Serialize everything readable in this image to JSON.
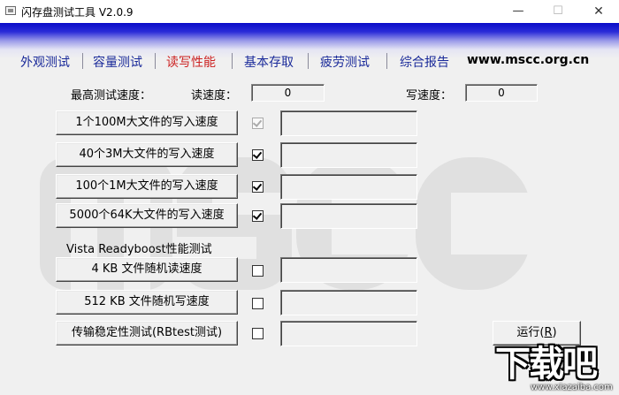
{
  "window": {
    "title": "闪存盘测试工具  V2.0.9",
    "minimize_symbol": "—",
    "maximize_symbol": "☐",
    "close_symbol": "✕"
  },
  "tabs": [
    {
      "label": "外观测试",
      "active": false
    },
    {
      "label": "容量测试",
      "active": false
    },
    {
      "label": "读写性能",
      "active": true
    },
    {
      "label": "基本存取",
      "active": false
    },
    {
      "label": "疲劳测试",
      "active": false
    },
    {
      "label": "综合报告",
      "active": false
    }
  ],
  "site_url": "www.mscc.org.cn",
  "speed": {
    "max_label": "最高测试速度：",
    "read_label": "读速度：",
    "read_value": "0",
    "write_label": "写速度：",
    "write_value": "0"
  },
  "tests": [
    {
      "label": "1个100M大文件的写入速度",
      "checked": true,
      "disabled": true
    },
    {
      "label": "40个3M大文件的写入速度",
      "checked": true,
      "disabled": false
    },
    {
      "label": "100个1M大文件的写入速度",
      "checked": true,
      "disabled": false
    },
    {
      "label": "5000个64K大文件的写入速度",
      "checked": true,
      "disabled": false
    }
  ],
  "readyboost_label": "Vista Readyboost性能测试",
  "readyboost_tests": [
    {
      "label": "4 KB  文件随机读速度",
      "checked": false
    },
    {
      "label": "512 KB  文件随机写速度",
      "checked": false
    }
  ],
  "stability_test": {
    "label": "传输稳定性测试(RBtest测试)",
    "checked": false
  },
  "run_button": {
    "label": "运行(",
    "mnemonic": "R",
    "suffix": ")"
  },
  "brand": {
    "main": "下载吧",
    "url": "www.xiazaiba.com"
  }
}
